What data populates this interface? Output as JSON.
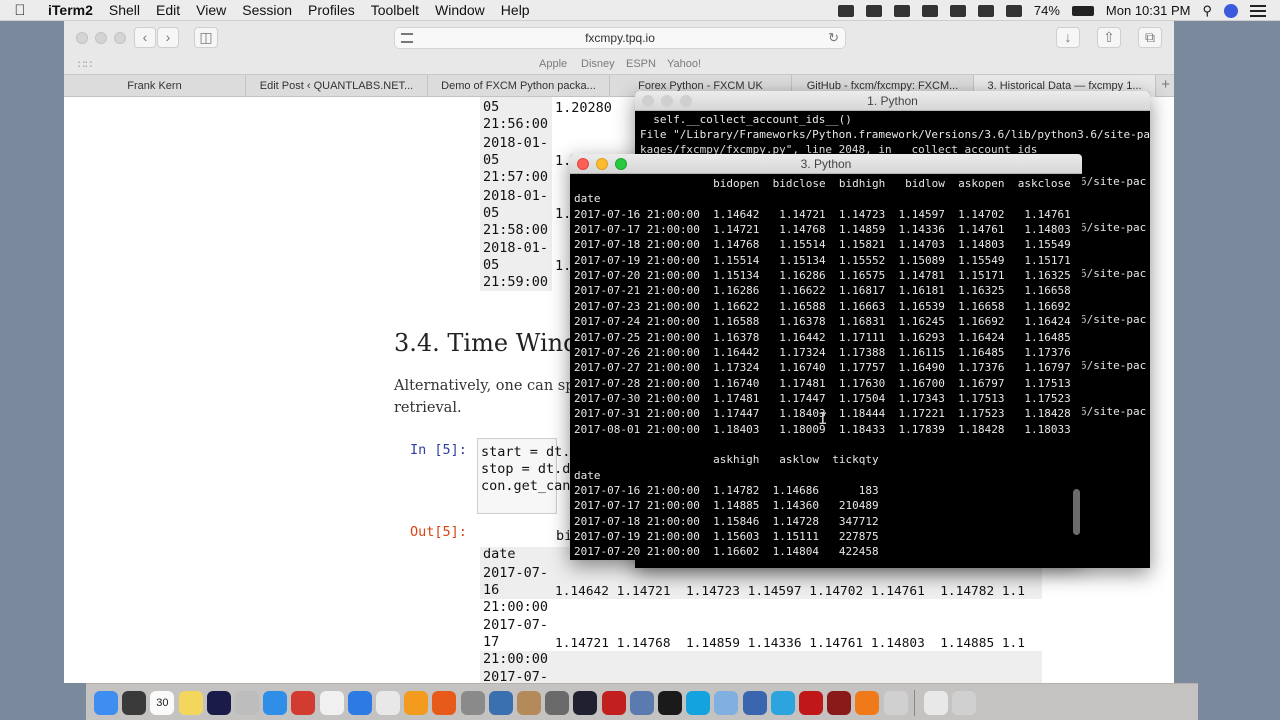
{
  "menubar": {
    "app": "iTerm2",
    "items": [
      "Shell",
      "Edit",
      "View",
      "Session",
      "Profiles",
      "Toolbelt",
      "Window",
      "Help"
    ],
    "battery": "74%",
    "clock": "Mon 10:31 PM"
  },
  "browser": {
    "url": "fxcmpy.tpq.io",
    "favorites": [
      "Apple",
      "Disney",
      "ESPN",
      "Yahoo!"
    ],
    "tabs": [
      "Frank Kern",
      "Edit Post ‹ QUANTLABS.NET...",
      "Demo of FXCM Python packa...",
      "Forex Python - FXCM UK",
      "GitHub - fxcm/fxcmpy: FXCM...",
      "3. Historical Data — fxcmpy 1..."
    ],
    "active_tab": 5
  },
  "notebook": {
    "top_rows": [
      {
        "date": "05",
        "time": "21:56:00",
        "val": "1.20280"
      },
      {
        "date": "2018-01-",
        "date2": "05",
        "time": "21:57:00",
        "val": "1."
      },
      {
        "date": "2018-01-",
        "date2": "05",
        "time": "21:58:00",
        "val": "1."
      },
      {
        "date": "2018-01-",
        "date2": "05",
        "time": "21:59:00",
        "val": "1."
      }
    ],
    "heading": "3.4. Time Windo",
    "para_line1": "Alternatively, one can spe",
    "para_line2": "retrieval.",
    "in_prompt": "In [5]:",
    "code": [
      "start = dt.",
      "stop = dt.d",
      "con.get_can"
    ],
    "out_prompt": "Out[5]:",
    "out_header": "bi",
    "out_index_label": "date",
    "out_rows": [
      {
        "d1": "2017-07-",
        "d2": "16",
        "d3": "21:00:00",
        "vals": "1.14642 1.14721  1.14723 1.14597 1.14702 1.14761  1.14782 1.1"
      },
      {
        "d1": "2017-07-",
        "d2": "17",
        "d3": "21:00:00",
        "vals": "1.14721 1.14768  1.14859 1.14336 1.14761 1.14803  1.14885 1.1"
      },
      {
        "d1": "2017-07-",
        "d2": "",
        "d3": "",
        "vals": ""
      }
    ]
  },
  "term1": {
    "title": "1. Python",
    "line1": "  self.__collect_account_ids__()",
    "line2": "File \"/Library/Frameworks/Python.framework/Versions/3.6/lib/python3.6/site-pac",
    "line3": "kages/fxcmpy/fxcmpy.py\", line 2048, in __collect_account_ids",
    "side_lines": [
      "6/site-pac",
      "6/site-pac",
      "6/site-pac",
      "6/site-pac",
      "6/site-pac",
      "6/site-pac"
    ]
  },
  "term3": {
    "title": "3. Python",
    "header1": "                     bidopen  bidclose  bidhigh   bidlow  askopen  askclose  \\",
    "index_label": "date",
    "rows1": [
      "2017-07-16 21:00:00  1.14642   1.14721  1.14723  1.14597  1.14702   1.14761",
      "2017-07-17 21:00:00  1.14721   1.14768  1.14859  1.14336  1.14761   1.14803",
      "2017-07-18 21:00:00  1.14768   1.15514  1.15821  1.14703  1.14803   1.15549",
      "2017-07-19 21:00:00  1.15514   1.15134  1.15552  1.15089  1.15549   1.15171",
      "2017-07-20 21:00:00  1.15134   1.16286  1.16575  1.14781  1.15171   1.16325",
      "2017-07-21 21:00:00  1.16286   1.16622  1.16817  1.16181  1.16325   1.16658",
      "2017-07-23 21:00:00  1.16622   1.16588  1.16663  1.16539  1.16658   1.16692",
      "2017-07-24 21:00:00  1.16588   1.16378  1.16831  1.16245  1.16692   1.16424",
      "2017-07-25 21:00:00  1.16378   1.16442  1.17111  1.16293  1.16424   1.16485",
      "2017-07-26 21:00:00  1.16442   1.17324  1.17388  1.16115  1.16485   1.17376",
      "2017-07-27 21:00:00  1.17324   1.16740  1.17757  1.16490  1.17376   1.16797",
      "2017-07-28 21:00:00  1.16740   1.17481  1.17630  1.16700  1.16797   1.17513",
      "2017-07-30 21:00:00  1.17481   1.17447  1.17504  1.17343  1.17513   1.17523",
      "2017-07-31 21:00:00  1.17447   1.18403  1.18444  1.17221  1.17523   1.18428",
      "2017-08-01 21:00:00  1.18403   1.18009  1.18433  1.17839  1.18428   1.18033"
    ],
    "header2": "                     askhigh   asklow  tickqty",
    "rows2": [
      "2017-07-16 21:00:00  1.14782  1.14686      183",
      "2017-07-17 21:00:00  1.14885  1.14360   210489",
      "2017-07-18 21:00:00  1.15846  1.14728   347712",
      "2017-07-19 21:00:00  1.15603  1.15111   227875",
      "2017-07-20 21:00:00  1.16602  1.14804   422458"
    ]
  },
  "dock_badge": "30"
}
